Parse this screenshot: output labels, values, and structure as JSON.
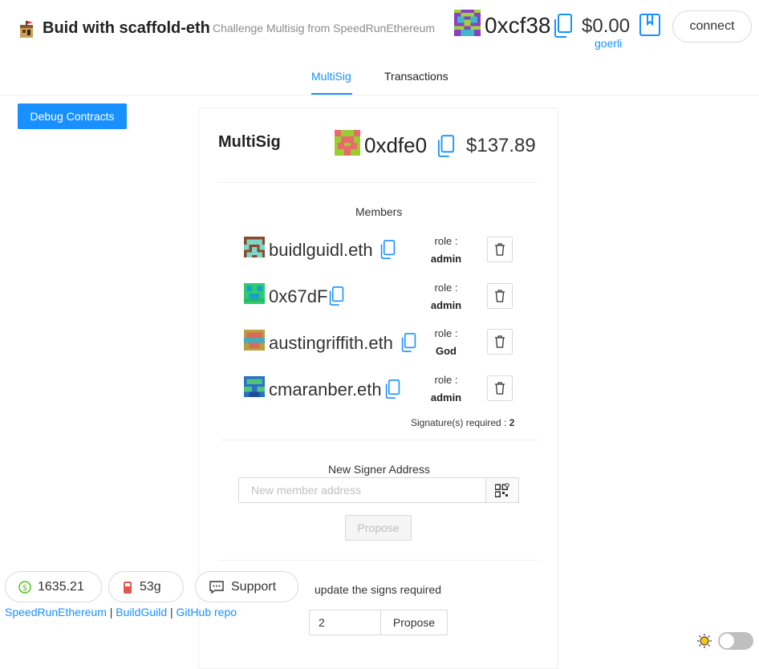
{
  "header": {
    "title": "Buid with scaffold-eth",
    "subtitle": "Challenge Multisig from SpeedRunEthereum",
    "account_address": "0xcf38",
    "account_balance": "$0.00",
    "network": "goerli",
    "connect_label": "connect"
  },
  "tabs": [
    {
      "label": "MultiSig",
      "active": true
    },
    {
      "label": "Transactions",
      "active": false
    }
  ],
  "debug_button": "Debug Contracts",
  "multisig": {
    "title": "MultiSig",
    "address": "0xdfe0",
    "balance": "$137.89",
    "members_title": "Members",
    "role_label": "role :",
    "members": [
      {
        "name": "buidlguidl.eth",
        "role": "admin"
      },
      {
        "name": "0x67dF",
        "role": "admin"
      },
      {
        "name": "austingriffith.eth",
        "role": "God"
      },
      {
        "name": "cmaranber.eth",
        "role": "admin"
      }
    ],
    "signatures_label": "Signature(s) required :",
    "signatures_value": "2",
    "new_signer_label": "New Signer Address",
    "new_member_placeholder": "New member address",
    "propose_label": "Propose",
    "update_label": "update the signs required",
    "signs_required_value": "2",
    "propose2_label": "Propose"
  },
  "footer": {
    "eth_price": "1635.21",
    "gas_price": "53g",
    "support_label": "Support",
    "links": [
      "SpeedRunEthereum",
      "BuildGuild",
      "GitHub repo"
    ],
    "separator": "|"
  },
  "colors": {
    "accent": "#1890ff",
    "text": "#262626",
    "border": "#d9d9d9"
  }
}
